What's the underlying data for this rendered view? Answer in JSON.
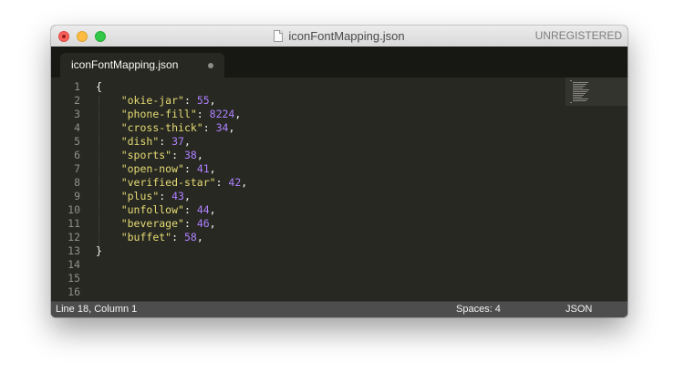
{
  "window": {
    "title": "iconFontMapping.json",
    "license_label": "UNREGISTERED"
  },
  "tab": {
    "label": "iconFontMapping.json"
  },
  "editor": {
    "line_numbers": [
      "1",
      "2",
      "3",
      "4",
      "5",
      "6",
      "7",
      "8",
      "9",
      "10",
      "11",
      "12",
      "13",
      "14",
      "15",
      "16"
    ],
    "open_brace": "{",
    "close_brace": "}",
    "entries": [
      {
        "key": "\"okie-jar\"",
        "value": "55",
        "sep": ","
      },
      {
        "key": "\"phone-fill\"",
        "value": "8224",
        "sep": ","
      },
      {
        "key": "\"cross-thick\"",
        "value": "34",
        "sep": ","
      },
      {
        "key": "\"dish\"",
        "value": "37",
        "sep": ","
      },
      {
        "key": "\"sports\"",
        "value": "38",
        "sep": ","
      },
      {
        "key": "\"open-now\"",
        "value": "41",
        "sep": ","
      },
      {
        "key": "\"verified-star\"",
        "value": "42",
        "sep": ","
      },
      {
        "key": "\"plus\"",
        "value": "43",
        "sep": ","
      },
      {
        "key": "\"unfollow\"",
        "value": "44",
        "sep": ","
      },
      {
        "key": "\"beverage\"",
        "value": "46",
        "sep": ","
      },
      {
        "key": "\"buffet\"",
        "value": "58",
        "sep": ","
      }
    ]
  },
  "statusbar": {
    "position": "Line 18, Column 1",
    "spaces": "Spaces: 4",
    "syntax": "JSON"
  },
  "icons": {
    "file": "document-icon",
    "traffic_lights": [
      "close-icon",
      "minimize-icon",
      "zoom-icon"
    ]
  },
  "colors": {
    "background": "#272822",
    "string": "#e6db74",
    "number": "#ae81ff",
    "text": "#f8f8f2",
    "gutter": "#8f908a"
  }
}
